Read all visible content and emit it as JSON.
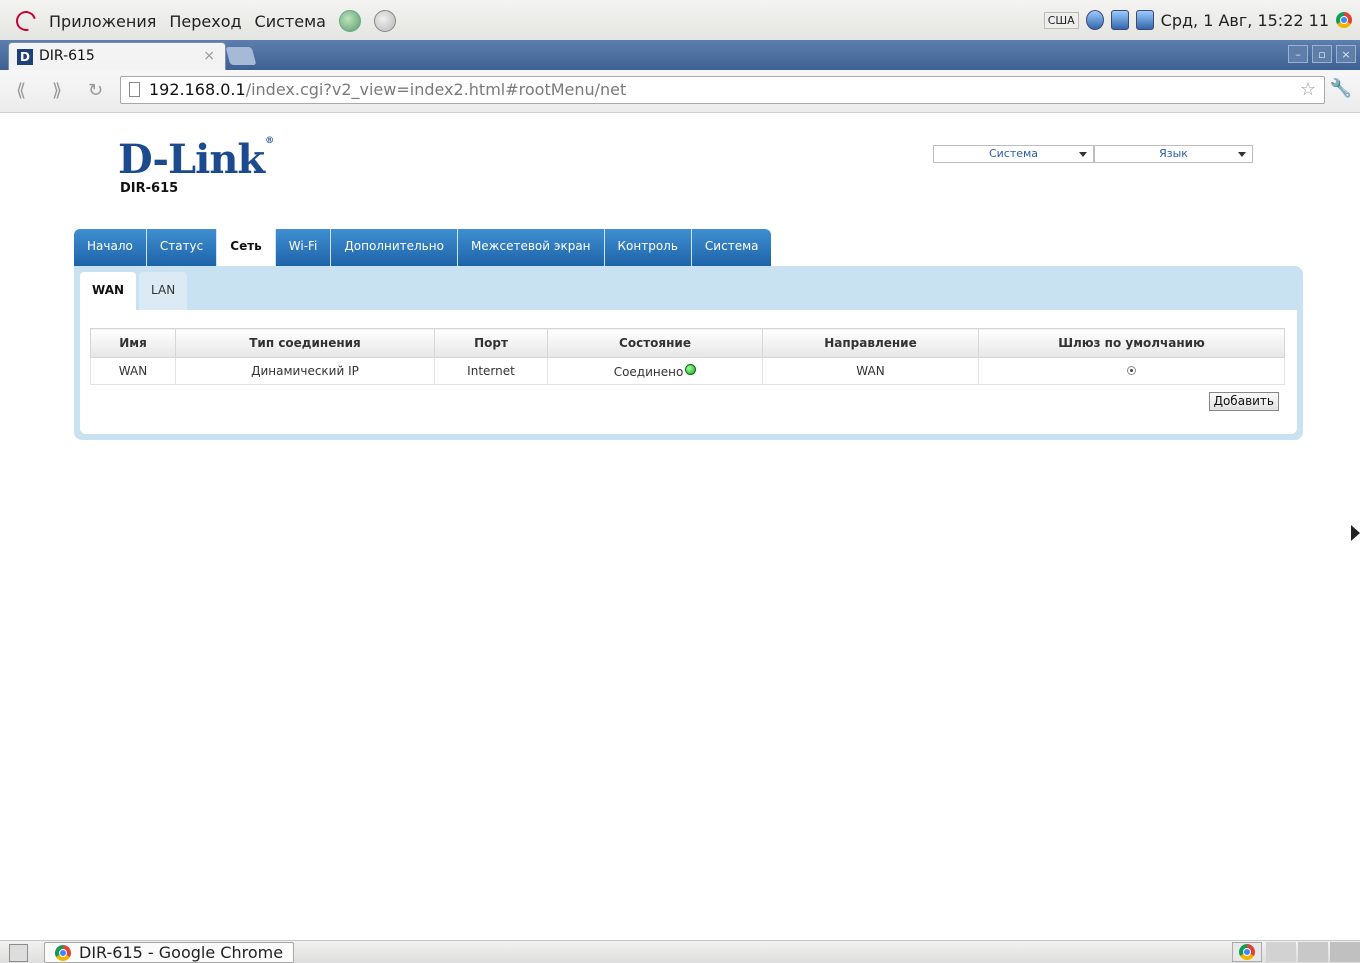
{
  "top_panel": {
    "menus": [
      "Приложения",
      "Переход",
      "Система"
    ],
    "keyboard_layout": "США",
    "clock": "Срд, 1 Авг, 15:22 11"
  },
  "browser": {
    "tab_title": "DIR-615",
    "tab_close": "×",
    "url_host": "192.168.0.1",
    "url_path": "/index.cgi?v2_view=index2.html#rootMenu/net",
    "window_buttons": [
      "–",
      "▫",
      "×"
    ]
  },
  "router": {
    "logo": "D-Link",
    "logo_mark": "®",
    "model": "DIR-615",
    "system_select": "Система",
    "language_select": "Язык",
    "main_tabs": [
      "Начало",
      "Статус",
      "Сеть",
      "Wi-Fi",
      "Дополнительно",
      "Межсетевой экран",
      "Контроль",
      "Система"
    ],
    "active_main_tab": "Сеть",
    "sub_tabs": [
      "WAN",
      "LAN"
    ],
    "active_sub_tab": "WAN",
    "table": {
      "headers": [
        "Имя",
        "Тип соединения",
        "Порт",
        "Состояние",
        "Направление",
        "Шлюз по умолчанию"
      ],
      "rows": [
        {
          "name": "WAN",
          "type": "Динамический IP",
          "port": "Internet",
          "state": "Соединено",
          "direction": "WAN",
          "default_gateway": true
        }
      ]
    },
    "add_button": "Добавить"
  },
  "taskbar": {
    "window_button": "DIR-615 - Google Chrome"
  }
}
